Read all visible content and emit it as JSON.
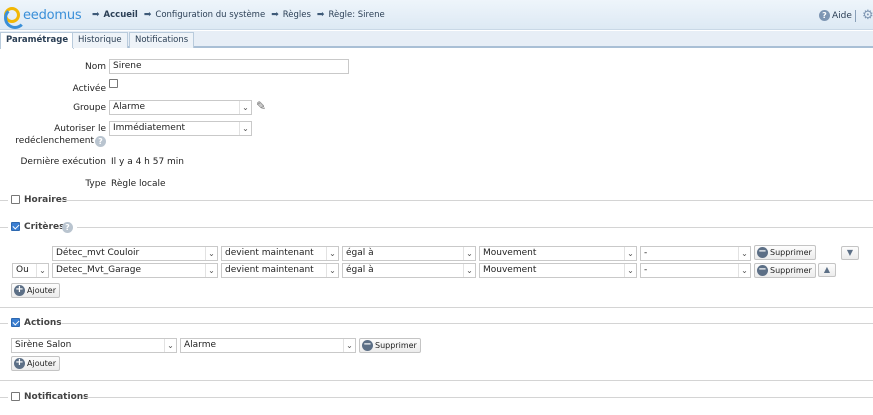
{
  "app": {
    "logo_text": "eedomus"
  },
  "breadcrumb": [
    "Accueil",
    "Configuration du système",
    "Règles",
    "Règle: Sirene"
  ],
  "header": {
    "help_label": "Aide"
  },
  "tabs": [
    {
      "label": "Paramétrage",
      "active": true
    },
    {
      "label": "Historique",
      "active": false
    },
    {
      "label": "Notifications",
      "active": false
    }
  ],
  "form": {
    "nom_label": "Nom",
    "nom_value": "Sirene",
    "activee_label": "Activée",
    "activee_checked": false,
    "groupe_label": "Groupe",
    "groupe_value": "Alarme",
    "autoriser_label_line1": "Autoriser le",
    "autoriser_label_line2": "redéclenchement",
    "autoriser_value": "Immédiatement",
    "derniere_label": "Dernière exécution",
    "derniere_value": "Il y a 4 h 57 min",
    "type_label": "Type",
    "type_value": "Règle locale"
  },
  "sections": {
    "horaires": {
      "title": "Horaires",
      "checked": false
    },
    "criteres": {
      "title": "Critères",
      "checked": true
    },
    "actions": {
      "title": "Actions",
      "checked": true
    },
    "notifications": {
      "title": "Notifications",
      "checked": false
    }
  },
  "criteres_rows": [
    {
      "connector": "",
      "device": "Détec_mvt Couloir",
      "condition": "devient maintenant",
      "operator": "égal à",
      "value": "Mouvement",
      "extra": "-",
      "delete_label": "Supprimer"
    },
    {
      "connector": "Ou",
      "device": "Detec_Mvt_Garage",
      "condition": "devient maintenant",
      "operator": "égal à",
      "value": "Mouvement",
      "extra": "-",
      "delete_label": "Supprimer"
    }
  ],
  "criteres_add_label": "Ajouter",
  "actions_rows": [
    {
      "device": "Sirène Salon",
      "value": "Alarme",
      "delete_label": "Supprimer"
    }
  ],
  "actions_add_label": "Ajouter",
  "icons": {
    "breadcrumb_arrow": "arrow-right-icon",
    "help": "help-icon",
    "settings": "gear-icon",
    "edit": "pencil-icon",
    "info": "question-icon",
    "remove": "minus-circle-icon",
    "add": "plus-circle-icon",
    "move_down": "triangle-down-icon",
    "move_up": "triangle-up-icon"
  }
}
